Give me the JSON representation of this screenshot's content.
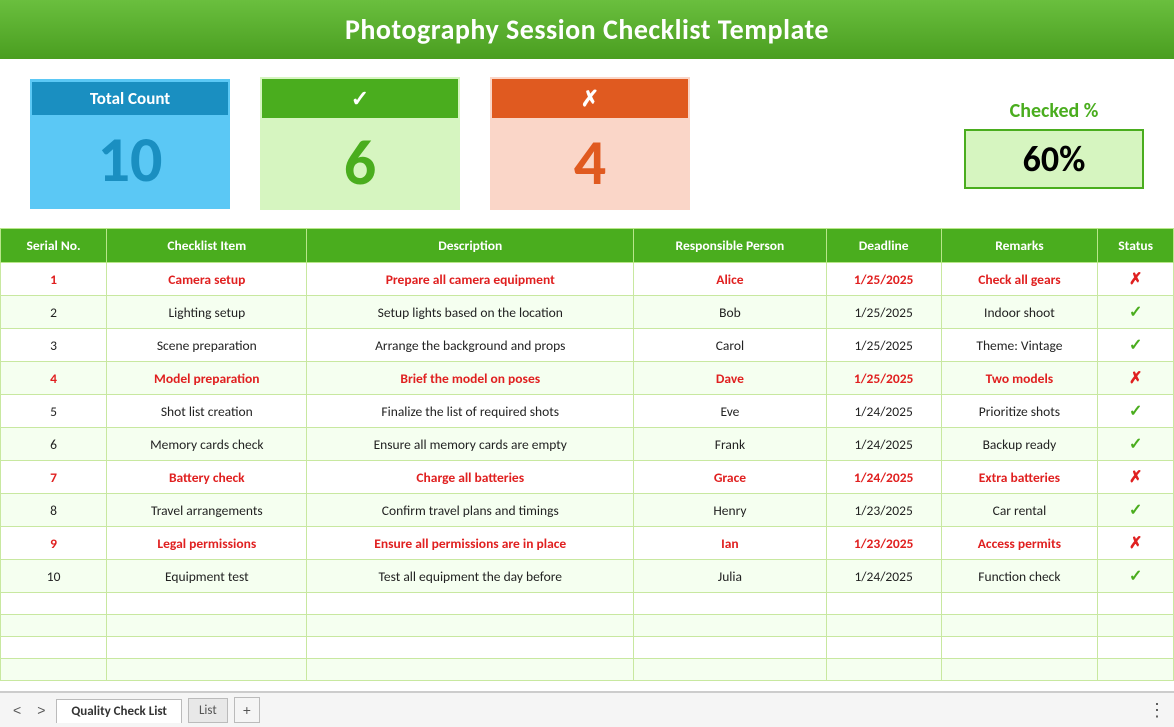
{
  "header": {
    "title": "Photography Session Checklist Template"
  },
  "summary": {
    "total_label": "Total Count",
    "total_value": "10",
    "checked_icon": "✓",
    "checked_value": "6",
    "unchecked_icon": "✗",
    "unchecked_value": "4",
    "percent_label": "Checked %",
    "percent_value": "60%"
  },
  "table": {
    "columns": [
      "Serial No.",
      "Checklist Item",
      "Description",
      "Responsible Person",
      "Deadline",
      "Remarks",
      "Status"
    ],
    "rows": [
      {
        "serial": "1",
        "item": "Camera setup",
        "description": "Prepare all camera equipment",
        "person": "Alice",
        "deadline": "1/25/2025",
        "remarks": "Check all gears",
        "status": "x",
        "highlight": true
      },
      {
        "serial": "2",
        "item": "Lighting setup",
        "description": "Setup lights based on the location",
        "person": "Bob",
        "deadline": "1/25/2025",
        "remarks": "Indoor shoot",
        "status": "check",
        "highlight": false
      },
      {
        "serial": "3",
        "item": "Scene preparation",
        "description": "Arrange the background and props",
        "person": "Carol",
        "deadline": "1/25/2025",
        "remarks": "Theme: Vintage",
        "status": "check",
        "highlight": false
      },
      {
        "serial": "4",
        "item": "Model preparation",
        "description": "Brief the model on poses",
        "person": "Dave",
        "deadline": "1/25/2025",
        "remarks": "Two models",
        "status": "x",
        "highlight": true
      },
      {
        "serial": "5",
        "item": "Shot list creation",
        "description": "Finalize the list of required shots",
        "person": "Eve",
        "deadline": "1/24/2025",
        "remarks": "Prioritize shots",
        "status": "check",
        "highlight": false
      },
      {
        "serial": "6",
        "item": "Memory cards check",
        "description": "Ensure all memory cards are empty",
        "person": "Frank",
        "deadline": "1/24/2025",
        "remarks": "Backup ready",
        "status": "check",
        "highlight": false
      },
      {
        "serial": "7",
        "item": "Battery check",
        "description": "Charge all batteries",
        "person": "Grace",
        "deadline": "1/24/2025",
        "remarks": "Extra batteries",
        "status": "x",
        "highlight": true
      },
      {
        "serial": "8",
        "item": "Travel arrangements",
        "description": "Confirm travel plans and timings",
        "person": "Henry",
        "deadline": "1/23/2025",
        "remarks": "Car rental",
        "status": "check",
        "highlight": false
      },
      {
        "serial": "9",
        "item": "Legal permissions",
        "description": "Ensure all permissions are in place",
        "person": "Ian",
        "deadline": "1/23/2025",
        "remarks": "Access permits",
        "status": "x",
        "highlight": true
      },
      {
        "serial": "10",
        "item": "Equipment test",
        "description": "Test all equipment the day before",
        "person": "Julia",
        "deadline": "1/24/2025",
        "remarks": "Function check",
        "status": "check",
        "highlight": false
      }
    ],
    "empty_rows": 4
  },
  "bottom": {
    "nav_prev": "<",
    "nav_next": ">",
    "tab1_label": "Quality Check List",
    "tab2_label": "List",
    "add_label": "+",
    "dots_label": "⋮"
  }
}
